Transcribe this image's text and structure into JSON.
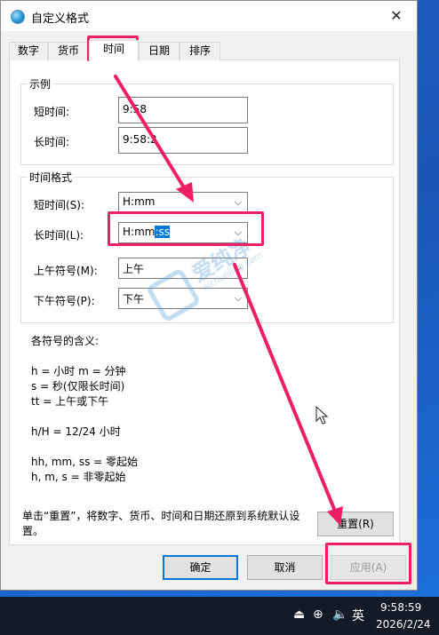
{
  "dialog": {
    "title": "自定义格式",
    "close_icon": "close-icon",
    "tabs": [
      {
        "label": "数字"
      },
      {
        "label": "货币"
      },
      {
        "label": "时间",
        "active": true
      },
      {
        "label": "日期"
      },
      {
        "label": "排序"
      }
    ]
  },
  "example": {
    "group_title": "示例",
    "short_label": "短时间:",
    "short_value": "9:58",
    "long_label": "长时间:",
    "long_value": "9:58:2"
  },
  "time_formats": {
    "group_title": "时间格式",
    "short_label": "短时间(S):",
    "short_value": "H:mm",
    "long_label": "长时间(L):",
    "long_value_unselected": "H:mm",
    "long_value_selected": ":ss",
    "am_label": "上午符号(M):",
    "am_value": "上午",
    "pm_label": "下午符号(P):",
    "pm_value": "下午"
  },
  "legend": {
    "heading": "各符号的含义:",
    "line1": "h = 小时    m = 分钟",
    "line2": "s = 秒(仅限长时间)",
    "line3": "tt = 上午或下午",
    "line4": "h/H = 12/24 小时",
    "line5": "hh, mm, ss = 零起始",
    "line6": "h, m, s = 非零起始"
  },
  "reset": {
    "note_line1": "单击“重置”，将数字、货币、时间和日期还原到系统默认设",
    "note_line2": "置。",
    "button": "重置(R)"
  },
  "footer": {
    "ok": "确定",
    "cancel": "取消",
    "apply": "应用(A)"
  },
  "watermark": {
    "title": "爱纯净",
    "subtitle": "aichunjing.com"
  },
  "taskbar": {
    "tray_icons": [
      "usb-icon",
      "network-icon",
      "volume-muted-icon"
    ],
    "ime": "英",
    "time": "9:58:59",
    "date": "2026/2/24"
  },
  "colors": {
    "highlight": "#ee1f67",
    "selection": "#0078d7",
    "desktop": "#1f64c9",
    "taskbar": "#141a26"
  }
}
